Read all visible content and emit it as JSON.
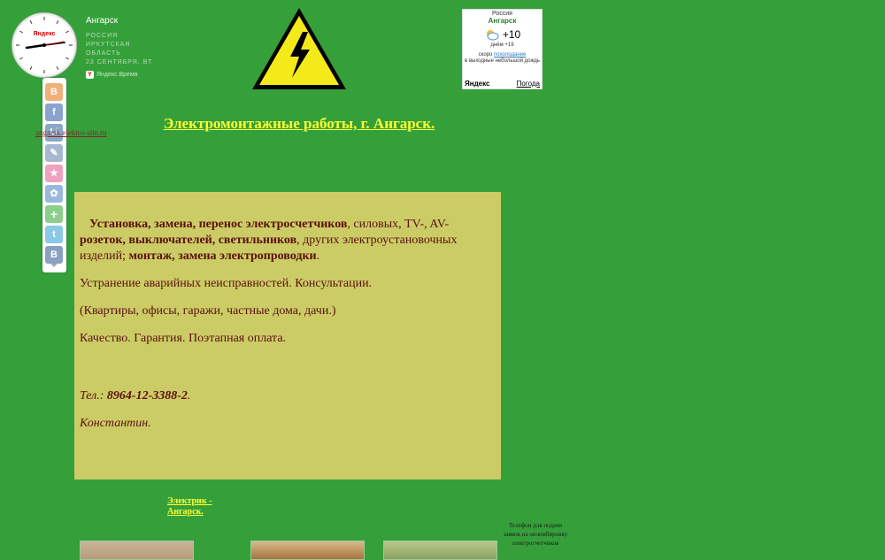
{
  "clock": {
    "brand_on_face": "Яндекс",
    "city": "Ангарск",
    "region_lines": [
      "РОССИЯ",
      "ИРКУТСКАЯ",
      "ОБЛАСТЬ",
      "23 СЕНТЯБРЯ, ВТ"
    ],
    "service": "Яндекс.Время"
  },
  "weather": {
    "country": "Россия",
    "city": "Ангарск",
    "temp": "+10",
    "day_temp": "днём +19",
    "note_prefix": "скоро",
    "note_link": "похолодание",
    "note_rest": "в выходные небольшой дождь",
    "brand": "Яндекс",
    "link": "Погода"
  },
  "share_buttons": [
    {
      "icon": "blogger-icon",
      "glyph": "B",
      "color": "#f0b07a"
    },
    {
      "icon": "facebook-icon",
      "glyph": "f",
      "color": "#8aa3cf"
    },
    {
      "icon": "liveinternet-icon",
      "glyph": "Li",
      "color": "#8aa8c8"
    },
    {
      "icon": "livejournal-icon",
      "glyph": "✎",
      "color": "#a8b8d0"
    },
    {
      "icon": "favorites-icon",
      "glyph": "★",
      "color": "#f0a0c0"
    },
    {
      "icon": "settings-icon",
      "glyph": "✿",
      "color": "#9ab8dc"
    },
    {
      "icon": "add-icon",
      "glyph": "+",
      "color": "#8ccf8c"
    },
    {
      "icon": "twitter-icon",
      "glyph": "t",
      "color": "#8cc8e8"
    },
    {
      "icon": "vkontakte-icon",
      "glyph": "B",
      "color": "#8aa0c0"
    }
  ],
  "hidden_link": "angarsk.elektro-site.ru",
  "title": "Электромонтажные работы, г. Ангарск.",
  "content": {
    "p1_b1": "Установка, замена, перенос электросчетчиков",
    "p1_t1": ", силовых, TV-, AV-",
    "p1_b2": "розеток, выключателей, светильников",
    "p1_t2": ", других электроустановочных изделий; ",
    "p1_b3": "монтаж, замена электропроводки",
    "p1_t3": ".",
    "p2": "Устранение аварийных неисправностей. Консультации.",
    "p3": "(Квартиры, офисы, гаражи, частные дома, дачи.)",
    "p4": "Качество. Гарантия. Поэтапная оплата.",
    "phone_label": "Тел.: ",
    "phone": "8964-12-3388-2",
    "phone_end": ".",
    "name": "Константин."
  },
  "electric_link": "Электрик - Ангарск.",
  "phone_note": "Телефон для подачи заявок на опломбировку электросчетчиков"
}
